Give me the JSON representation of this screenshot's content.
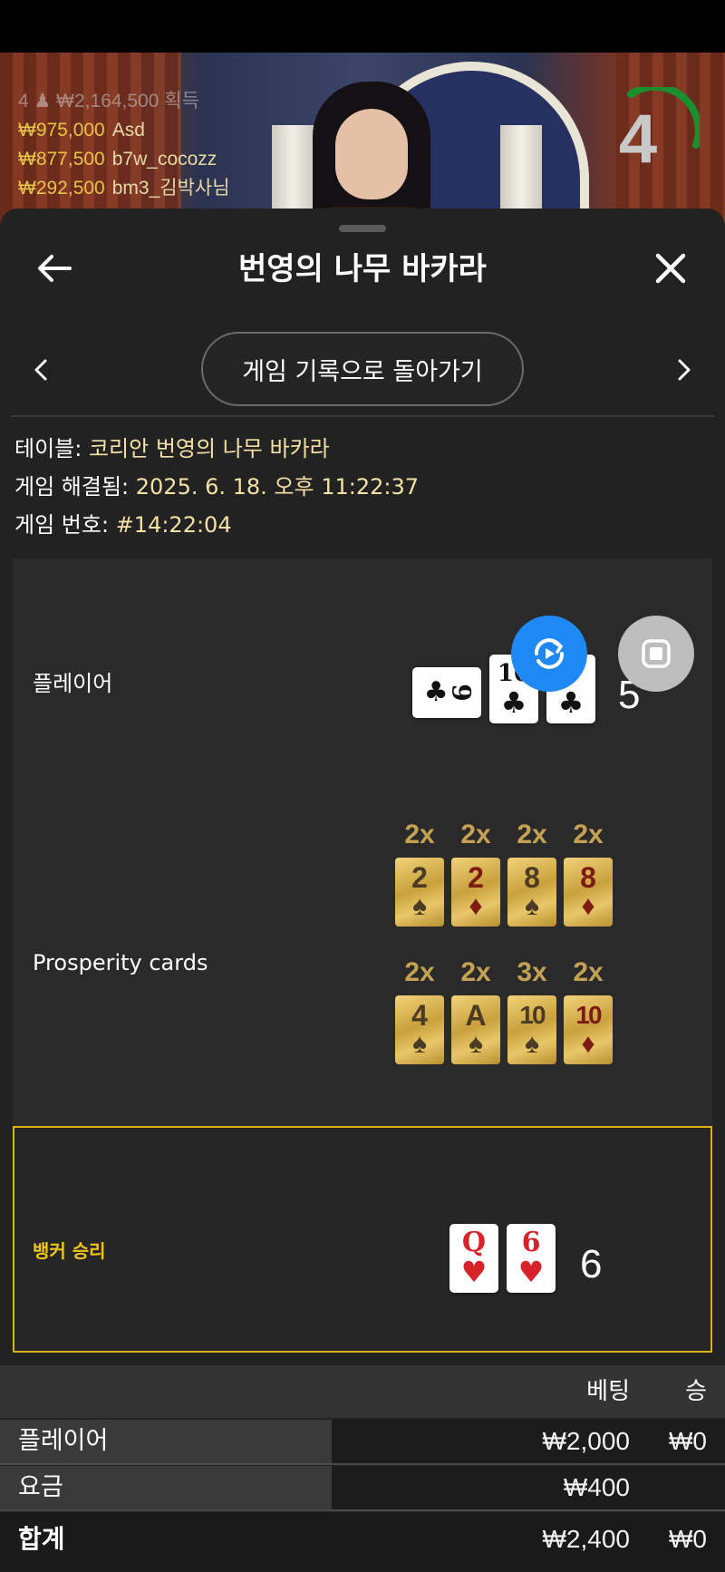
{
  "stream": {
    "winners_header": "4 ♟ ₩2,164,500 획득",
    "winners": [
      {
        "amount": "₩975,000",
        "name": "Asd"
      },
      {
        "amount": "₩877,500",
        "name": "b7w_cocozz"
      },
      {
        "amount": "₩292,500",
        "name": "bm3_김박사님"
      }
    ],
    "countdown": "4",
    "countdown_color": "#1a8f2e"
  },
  "header": {
    "title": "번영의 나무 바카라",
    "back_icon": "arrow-left-icon",
    "close_icon": "close-icon"
  },
  "nav": {
    "return_label": "게임 기록으로 돌아가기",
    "prev_icon": "chevron-left-icon",
    "next_icon": "chevron-right-icon"
  },
  "info": {
    "table_key": "테이블:",
    "table_value": "코리안 번영의 나무 바카라",
    "resolved_key": "게임 해결됨:",
    "resolved_value": "2025. 6. 18. 오후 11:22:37",
    "number_key": "게임 번호:",
    "number_value": "#14:22:04"
  },
  "game": {
    "player_label": "플레이어",
    "player_score": "5",
    "player_cards": [
      {
        "rank": "9",
        "suit": "♣",
        "color": "black",
        "rotated": true
      },
      {
        "rank": "10",
        "suit": "♣",
        "color": "black"
      },
      {
        "rank": "5",
        "suit": "♣",
        "color": "black"
      }
    ],
    "prosperity_label": "Prosperity cards",
    "prosperity_cards": [
      {
        "mult": "2x",
        "rank": "2",
        "suit": "♠",
        "color": "dark"
      },
      {
        "mult": "2x",
        "rank": "2",
        "suit": "♦",
        "color": "red"
      },
      {
        "mult": "2x",
        "rank": "8",
        "suit": "♠",
        "color": "dark"
      },
      {
        "mult": "2x",
        "rank": "8",
        "suit": "♦",
        "color": "red"
      },
      {
        "mult": "2x",
        "rank": "4",
        "suit": "♠",
        "color": "dark"
      },
      {
        "mult": "2x",
        "rank": "A",
        "suit": "♠",
        "color": "dark"
      },
      {
        "mult": "3x",
        "rank": "10",
        "suit": "♠",
        "color": "dark"
      },
      {
        "mult": "2x",
        "rank": "10",
        "suit": "♦",
        "color": "red"
      }
    ],
    "banker_label": "뱅커 승리",
    "banker_score": "6",
    "banker_cards": [
      {
        "rank": "Q",
        "suit": "♥",
        "color": "red"
      },
      {
        "rank": "6",
        "suit": "♥",
        "color": "red"
      }
    ],
    "replay_icon": "replay-icon",
    "stop_icon": "stop-icon"
  },
  "bets": {
    "col_bet": "베팅",
    "col_win": "승",
    "rows": [
      {
        "label": "플레이어",
        "bet": "₩2,000",
        "win": "₩0"
      },
      {
        "label": "요금",
        "bet": "₩400",
        "win": ""
      }
    ],
    "total": {
      "label": "합계",
      "bet": "₩2,400",
      "win": "₩0"
    }
  },
  "colors": {
    "accent_gold": "#d9b21a",
    "replay_blue": "#1e88f5",
    "info_value": "#f4e1a6"
  }
}
